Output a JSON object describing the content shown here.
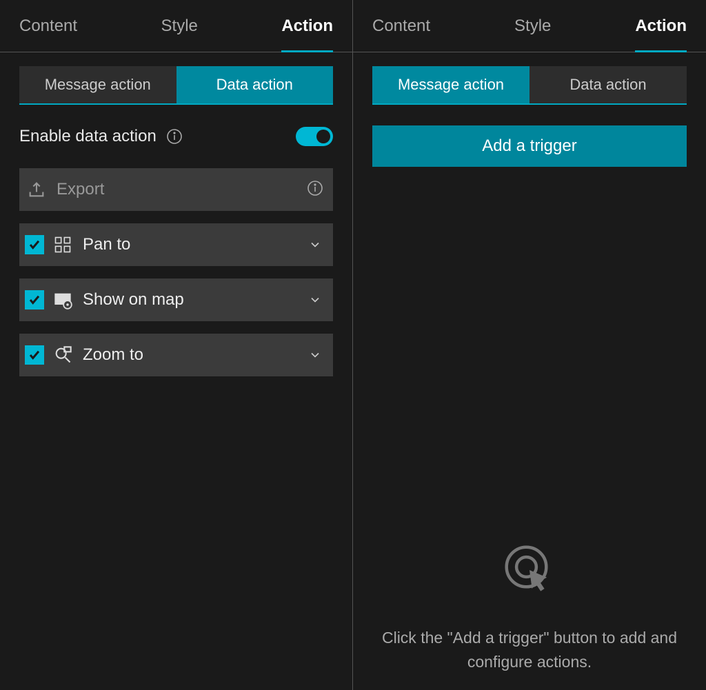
{
  "left_panel": {
    "tabs": {
      "content": "Content",
      "style": "Style",
      "action": "Action"
    },
    "subtabs": {
      "message": "Message action",
      "data": "Data action"
    },
    "toggle_label": "Enable data action",
    "actions": {
      "export": "Export",
      "pan_to": "Pan to",
      "show_on_map": "Show on map",
      "zoom_to": "Zoom to"
    }
  },
  "right_panel": {
    "tabs": {
      "content": "Content",
      "style": "Style",
      "action": "Action"
    },
    "subtabs": {
      "message": "Message action",
      "data": "Data action"
    },
    "add_trigger": "Add a trigger",
    "empty_state": "Click the \"Add a trigger\" button to add and configure actions."
  }
}
